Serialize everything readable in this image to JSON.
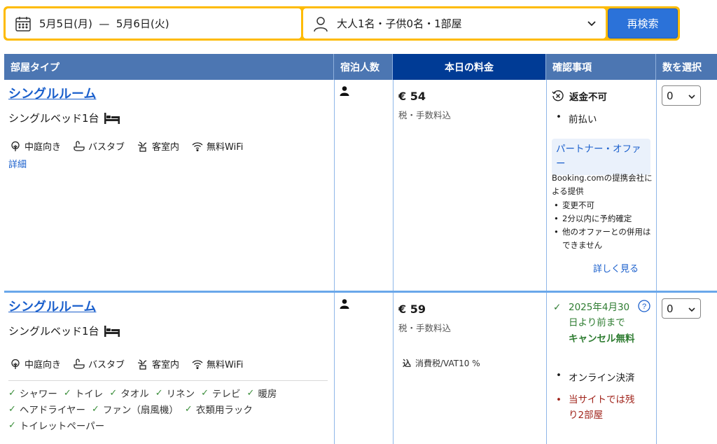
{
  "search": {
    "dates": "5月5日(月)  —  5月6日(火)",
    "guests": "大人1名・子供0名・1部屋",
    "button": "再検索"
  },
  "table": {
    "headers": {
      "room_type": "部屋タイプ",
      "occupancy": "宿泊人数",
      "price": "本日の料金",
      "conditions": "確認事項",
      "select": "数を選択"
    }
  },
  "rows": [
    {
      "room_name": "シングルルーム",
      "bed": "シングルベッド1台",
      "facilities": [
        "中庭向き",
        "バスタブ",
        "客室内",
        "無料WiFi"
      ],
      "detail_link": "詳細",
      "price": "€ 54",
      "price_note": "税・手数料込",
      "policy_title": "返金不可",
      "payment": "前払い",
      "partner_offer": "パートナー・オファー",
      "partner_desc": "Booking.comの提携会社による提供",
      "partner_points": [
        "変更不可",
        "2分以内に予約確定",
        "他のオファーとの併用はできません"
      ],
      "more_link": "詳しく見る",
      "select_value": "0"
    },
    {
      "room_name": "シングルルーム",
      "bed": "シングルベッド1台",
      "facilities": [
        "中庭向き",
        "バスタブ",
        "客室内",
        "無料WiFi"
      ],
      "amenities": [
        "シャワー",
        "トイレ",
        "タオル",
        "リネン",
        "テレビ",
        "暖房",
        "ヘアドライヤー",
        "ファン（扇風機）",
        "衣類用ラック",
        "トイレットペーパー"
      ],
      "price": "€ 59",
      "price_note": "税・手数料込",
      "vat_prefix": "込",
      "vat_text": "消費税/VAT10 %",
      "cancel_date": "2025年4月30日より前まで",
      "cancel_free": "キャンセル無料",
      "payment": "オンライン決済",
      "rooms_left": "当サイトでは残り2部屋",
      "select_value": "0"
    }
  ],
  "colors": {
    "header_bg": "#4c76b2",
    "price_header_bg": "#003b95",
    "search_border": "#febb02",
    "search_button": "#2b72d9",
    "link": "#1a5fcc",
    "green": "#2f7d32",
    "red": "#a0241b"
  }
}
